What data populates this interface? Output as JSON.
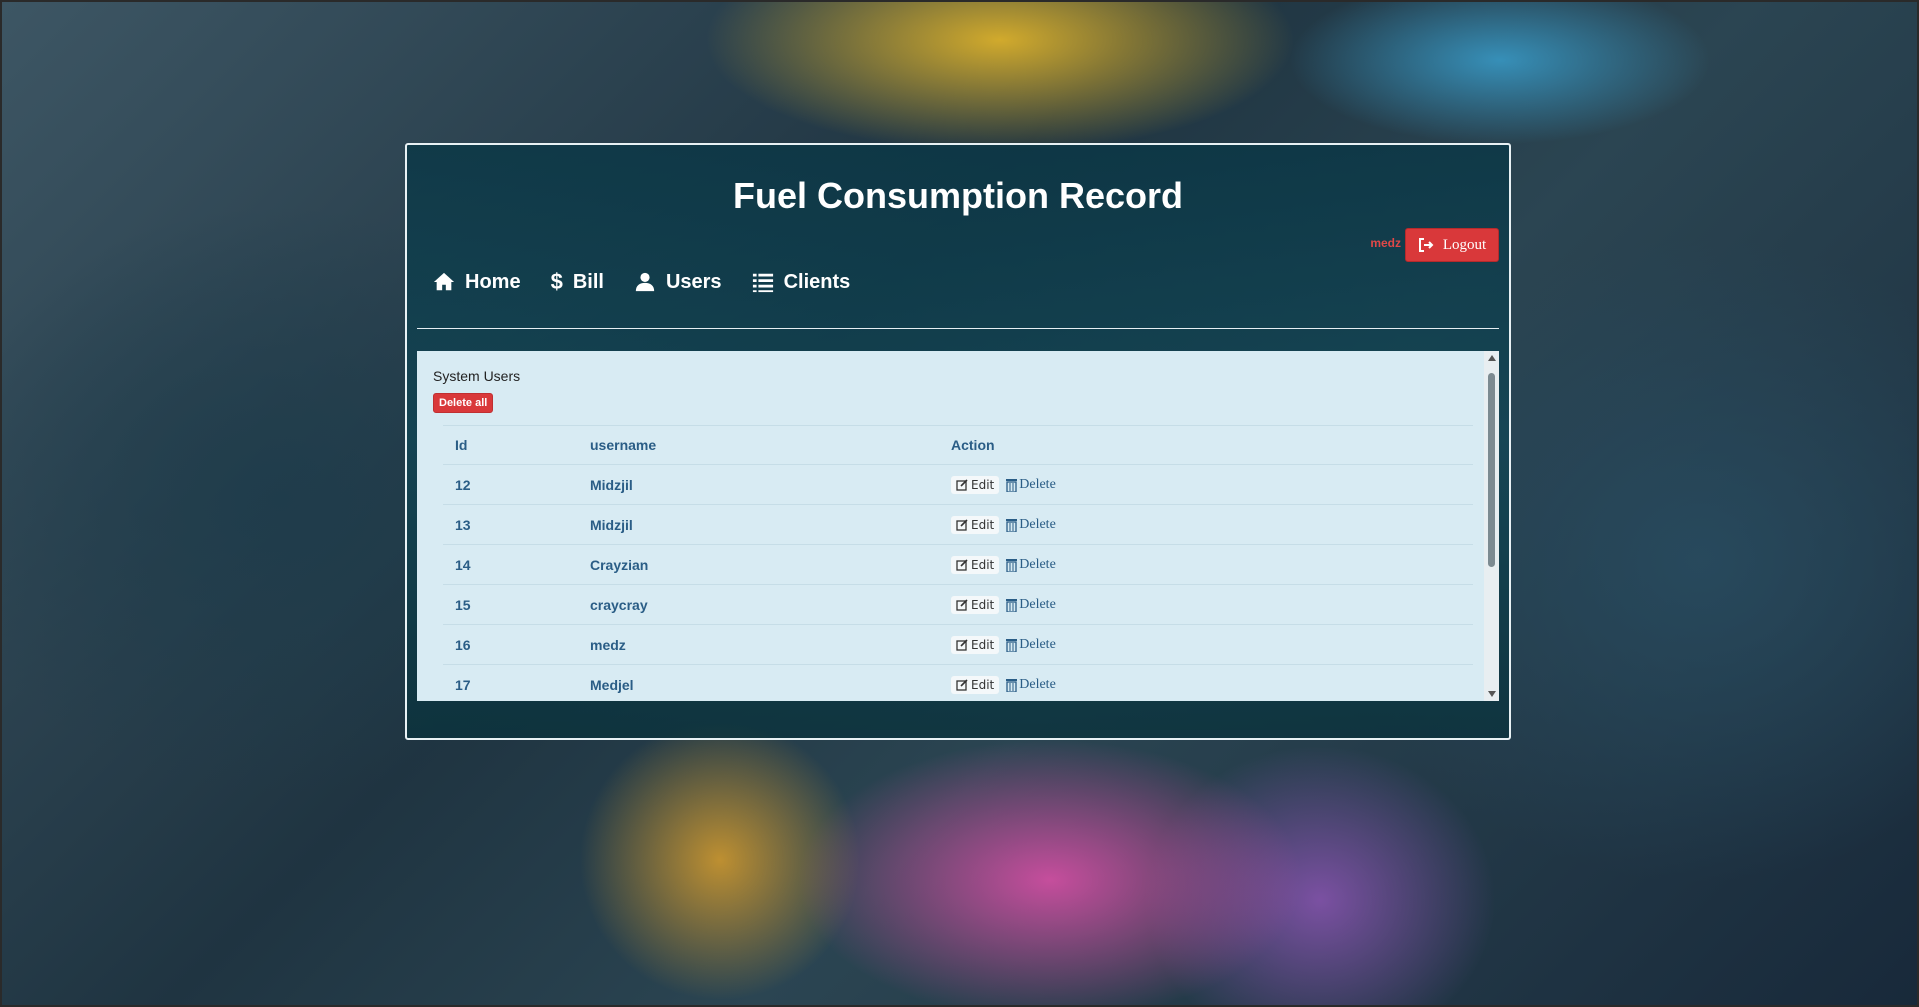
{
  "header": {
    "title": "Fuel Consumption Record",
    "current_user": "medz",
    "logout_label": "Logout"
  },
  "nav": {
    "items": [
      {
        "label": "Home",
        "icon": "home-icon"
      },
      {
        "label": "Bill",
        "icon": "dollar-icon"
      },
      {
        "label": "Users",
        "icon": "user-icon"
      },
      {
        "label": "Clients",
        "icon": "list-icon"
      }
    ]
  },
  "users_section": {
    "title": "System Users",
    "delete_all_label": "Delete all",
    "columns": [
      "Id",
      "username",
      "Action"
    ],
    "edit_label": "Edit",
    "delete_label": "Delete",
    "rows": [
      {
        "id": "12",
        "username": "Midzjil"
      },
      {
        "id": "13",
        "username": "Midzjil"
      },
      {
        "id": "14",
        "username": "Crayzian"
      },
      {
        "id": "15",
        "username": "craycray"
      },
      {
        "id": "16",
        "username": "medz"
      },
      {
        "id": "17",
        "username": "Medjel"
      }
    ]
  },
  "colors": {
    "danger": "#d9383a",
    "table_text": "#2a5d86",
    "content_bg": "#d8ebf3"
  }
}
